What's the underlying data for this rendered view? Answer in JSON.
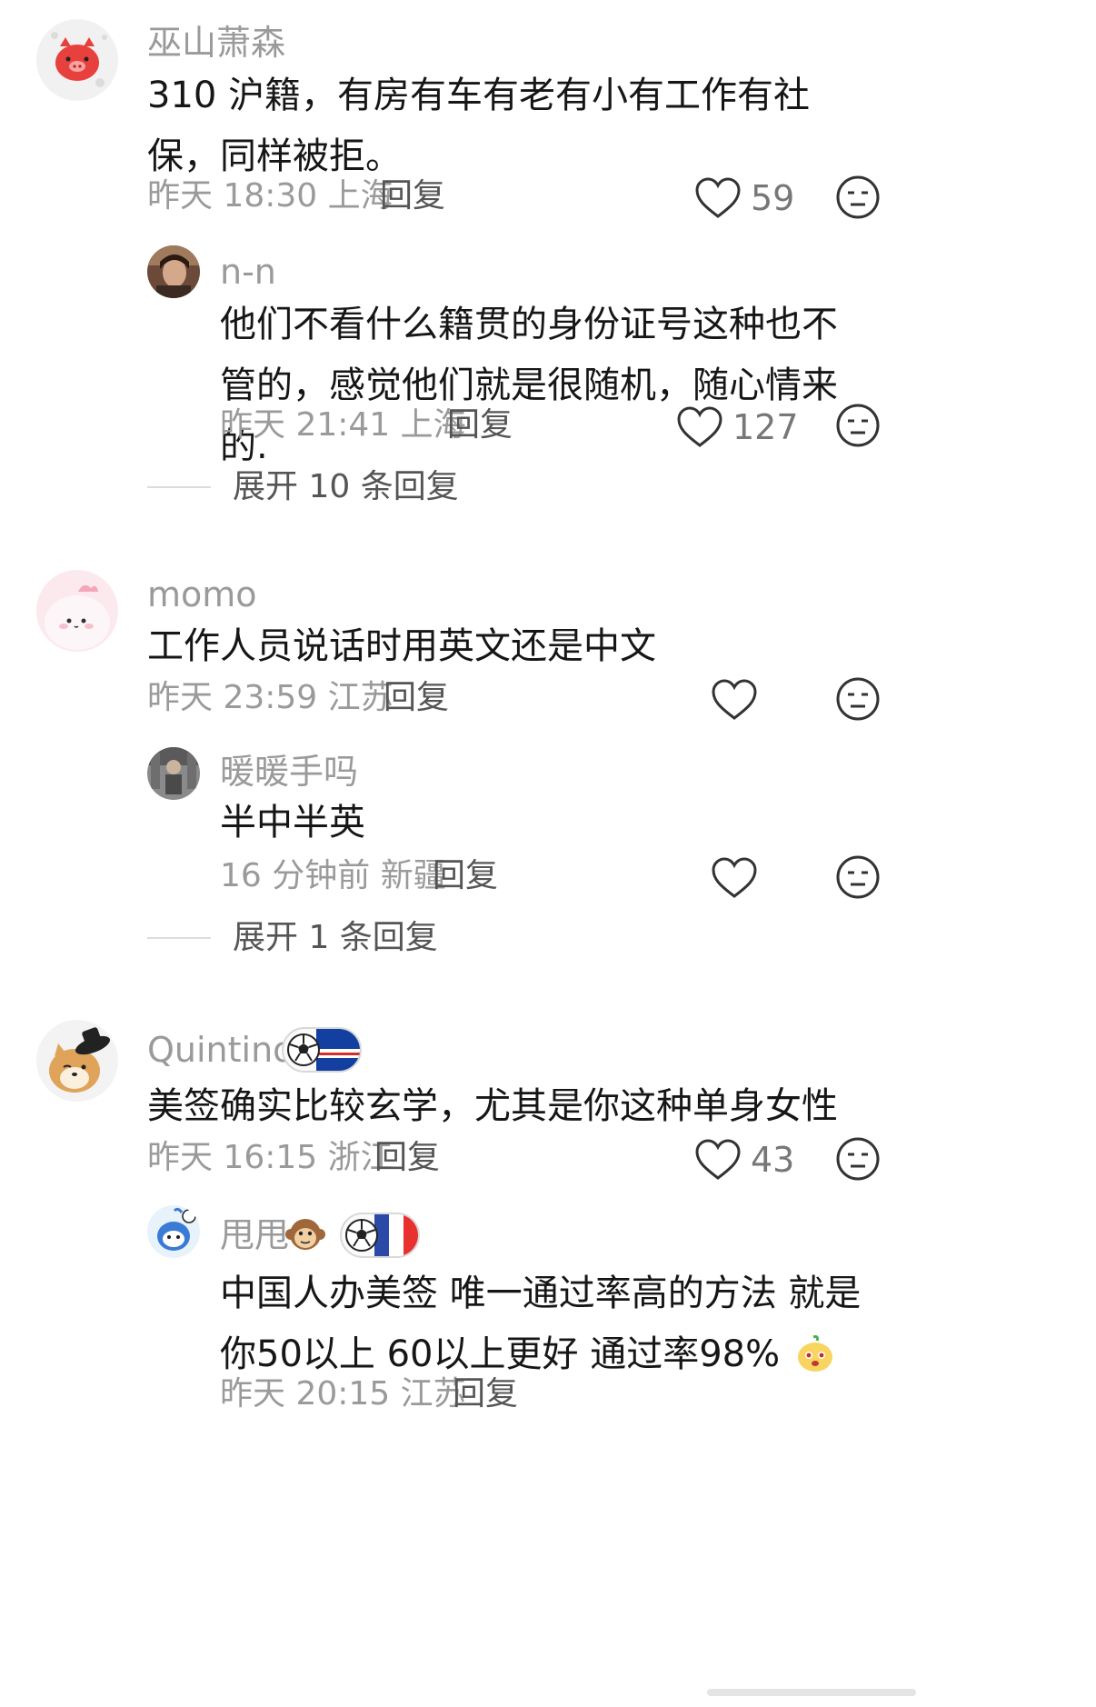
{
  "comments": [
    {
      "username": "巫山萧森",
      "content": "310 沪籍，有房有车有老有小有工作有社保，同样被拒。",
      "meta": "昨天 18:30 上海",
      "reply_label": "回复",
      "likes": "59",
      "avatar_icon": "red-pig-face-icon",
      "replies": [
        {
          "username": "n-n",
          "content": "他们不看什么籍贯的身份证号这种也不管的，感觉他们就是很随机，随心情来的.",
          "meta": "昨天 21:41 上海",
          "reply_label": "回复",
          "likes": "127",
          "avatar_icon": "photo-portrait-icon"
        }
      ],
      "expand_label": "展开 10 条回复"
    },
    {
      "username": "momo",
      "content": "工作人员说话时用英文还是中文",
      "meta": "昨天 23:59 江苏",
      "reply_label": "回复",
      "likes": "",
      "avatar_icon": "pink-bunny-icon",
      "replies": [
        {
          "username": "暖暖手吗",
          "content": "半中半英",
          "meta": "16 分钟前 新疆",
          "reply_label": "回复",
          "likes": "",
          "avatar_icon": "photo-figure-icon"
        }
      ],
      "expand_label": "展开 1 条回复"
    },
    {
      "username": "Quintino",
      "badge_icon": "soccer-ball-cape-verde-flag-icon",
      "content": "美签确实比较玄学，尤其是你这种单身女性",
      "meta": "昨天 16:15 浙江",
      "reply_label": "回复",
      "likes": "43",
      "avatar_icon": "shiba-dog-hat-icon",
      "replies": [
        {
          "username": "甩甩",
          "username_emoji": "monkey-face-icon",
          "badge_icon": "soccer-ball-france-flag-icon",
          "content": "中国人办美签 唯一通过率高的方法 就是你50以上 60以上更好 通过率98%",
          "content_emoji": "cute-lemon-face-icon",
          "meta": "昨天 20:15 江苏",
          "reply_label": "回复",
          "avatar_icon": "blue-cartoon-icon"
        }
      ]
    }
  ],
  "icons": {
    "like": "heart-outline-icon",
    "dislike": "neutral-face-icon"
  },
  "colors": {
    "username": "#9a9a9a",
    "text": "#161616",
    "meta": "#9a9a9a",
    "reply": "#555555",
    "divider": "#dcdcdc"
  }
}
